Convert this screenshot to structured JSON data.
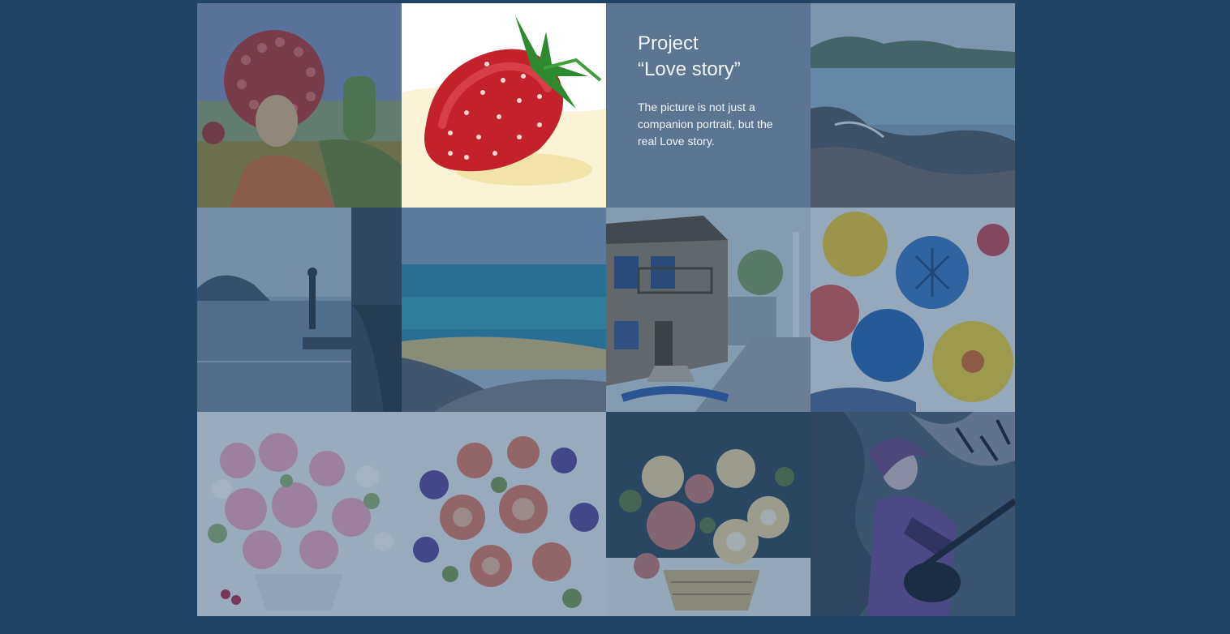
{
  "project": {
    "title_line1": "Project",
    "title_line2": "“Love story”",
    "description": "The picture is not just a companion portrait, but the real Love story."
  },
  "colors": {
    "background": "#1f4466",
    "info_panel": "#5b7592",
    "text": "#f2f5f8"
  },
  "gallery": {
    "tiles": [
      {
        "id": "portrait-afro",
        "row": 1,
        "col": 1,
        "highlighted": false
      },
      {
        "id": "strawberry",
        "row": 1,
        "col": 2,
        "highlighted": true
      },
      {
        "id": "project-info",
        "row": 1,
        "col": 3,
        "highlighted": false
      },
      {
        "id": "rocky-coast",
        "row": 1,
        "col": 4,
        "highlighted": false
      },
      {
        "id": "fisherman-pier",
        "row": 2,
        "col": 1,
        "highlighted": false
      },
      {
        "id": "sea-beach",
        "row": 2,
        "col": 2,
        "highlighted": false
      },
      {
        "id": "old-street-house",
        "row": 2,
        "col": 3,
        "highlighted": false
      },
      {
        "id": "abstract-flowers",
        "row": 2,
        "col": 4,
        "highlighted": false
      },
      {
        "id": "roses-vase",
        "row": 3,
        "col": 1,
        "highlighted": false
      },
      {
        "id": "flower-bouquet",
        "row": 3,
        "col": 2,
        "highlighted": false
      },
      {
        "id": "flower-basket",
        "row": 3,
        "col": 3,
        "highlighted": false
      },
      {
        "id": "guitar-girl",
        "row": 3,
        "col": 4,
        "highlighted": false
      }
    ]
  }
}
